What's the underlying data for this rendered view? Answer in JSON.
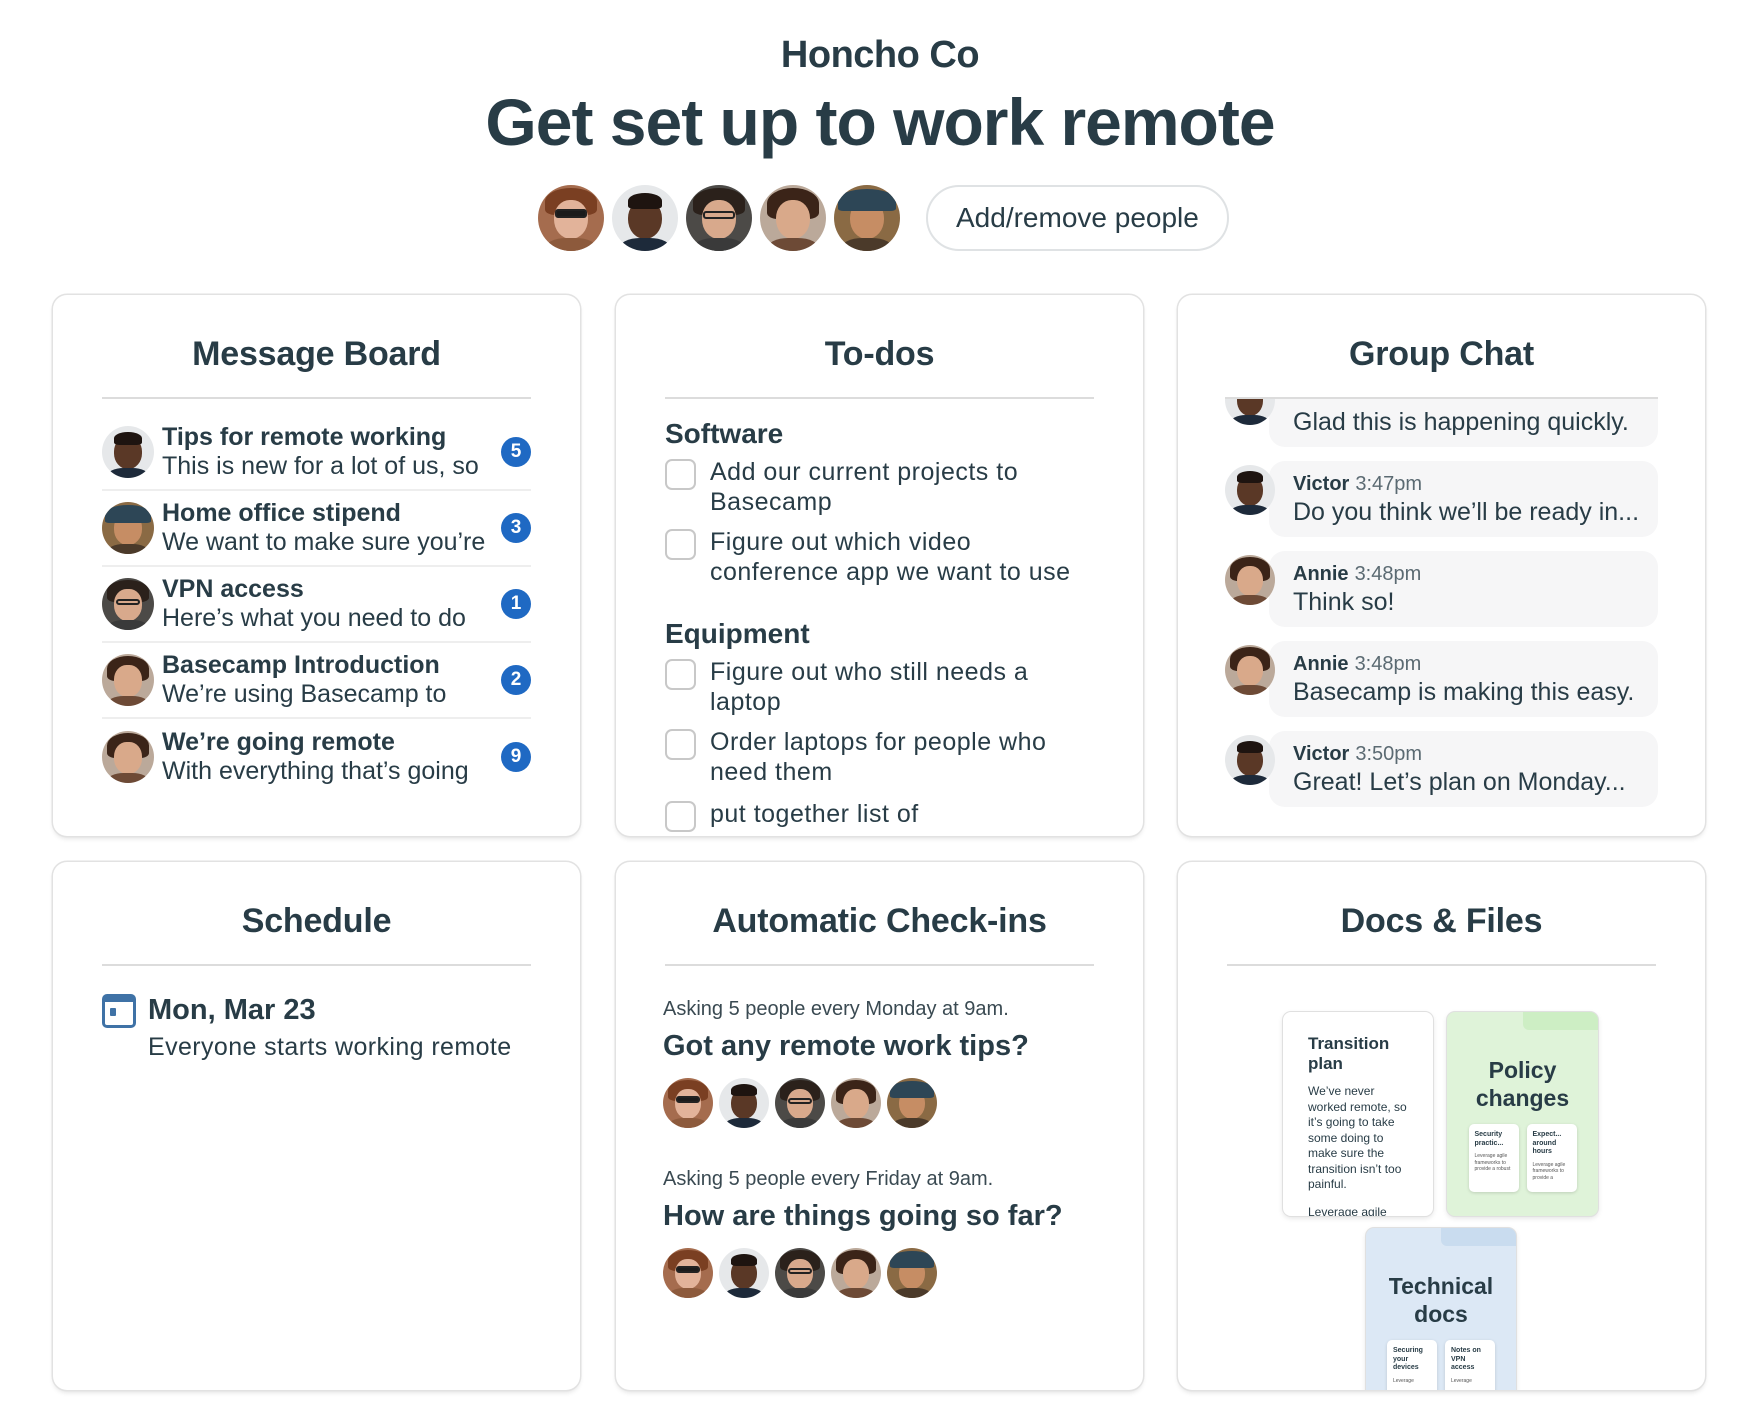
{
  "header": {
    "company": "Honcho Co",
    "headline": "Get set up to work remote",
    "add_remove_label": "Add/remove people",
    "people": [
      "person-1",
      "person-2",
      "person-3",
      "person-4",
      "person-5"
    ]
  },
  "colors": {
    "text": "#283c46",
    "badge": "#1f69c3",
    "calendar": "#3f72a6",
    "chat_bubble": "#f6f6f7",
    "policy_folder": "#dff3d9",
    "technical_folder": "#dce8f5"
  },
  "message_board": {
    "title": "Message Board",
    "items": [
      {
        "title": "Tips for remote working",
        "excerpt": "This is new for a lot of us, so",
        "count": "5"
      },
      {
        "title": "Home office stipend",
        "excerpt": "We want to make sure you’re",
        "count": "3"
      },
      {
        "title": "VPN access",
        "excerpt": "Here’s what you need to do",
        "count": "1"
      },
      {
        "title": "Basecamp Introduction",
        "excerpt": "We’re using Basecamp to",
        "count": "2"
      },
      {
        "title": "We’re going remote",
        "excerpt": "With everything that’s going",
        "count": "9"
      }
    ]
  },
  "todos": {
    "title": "To-dos",
    "groups": [
      {
        "name": "Software",
        "items": [
          "Add our current projects to Basecamp",
          "Figure out which video conference app we want to use"
        ]
      },
      {
        "name": "Equipment",
        "items": [
          "Figure out who still needs a laptop",
          "Order laptops for people who need them",
          "put together list of"
        ]
      }
    ]
  },
  "group_chat": {
    "title": "Group Chat",
    "messages": [
      {
        "author": "",
        "time": "",
        "text": "Glad this is happening quickly."
      },
      {
        "author": "Victor",
        "time": "3:47pm",
        "text": "Do you think we’ll be ready in..."
      },
      {
        "author": "Annie",
        "time": "3:48pm",
        "text": "Think so!"
      },
      {
        "author": "Annie",
        "time": "3:48pm",
        "text": "Basecamp is making this easy."
      },
      {
        "author": "Victor",
        "time": "3:50pm",
        "text": "Great! Let’s plan on Monday..."
      }
    ]
  },
  "schedule": {
    "title": "Schedule",
    "events": [
      {
        "date": "Mon, Mar 23",
        "description": "Everyone starts working remote"
      }
    ]
  },
  "checkins": {
    "title": "Automatic Check-ins",
    "questions": [
      {
        "schedule": "Asking 5 people every Monday at 9am.",
        "question": "Got any remote work tips?"
      },
      {
        "schedule": "Asking 5 people every Friday at 9am.",
        "question": "How are things going so far?"
      }
    ]
  },
  "docs": {
    "title": "Docs & Files",
    "transition_plan": {
      "title": "Transition plan",
      "text": "We’ve never worked remote, so it’s going to take some doing to make sure the transition isn’t too painful.",
      "more": "Leverage agile"
    },
    "policy_folder": {
      "title": "Policy changes",
      "docs": [
        {
          "title": "Security practic...",
          "text": "Leverage agile frameworks to provide a robust"
        },
        {
          "title": "Expect... around hours",
          "text": "Leverage agile frameworks to provide a"
        }
      ]
    },
    "technical_folder": {
      "title": "Technical docs",
      "docs": [
        {
          "title": "Securing your devices",
          "text": "Leverage"
        },
        {
          "title": "Notes on VPN access",
          "text": "Leverage"
        }
      ]
    }
  }
}
